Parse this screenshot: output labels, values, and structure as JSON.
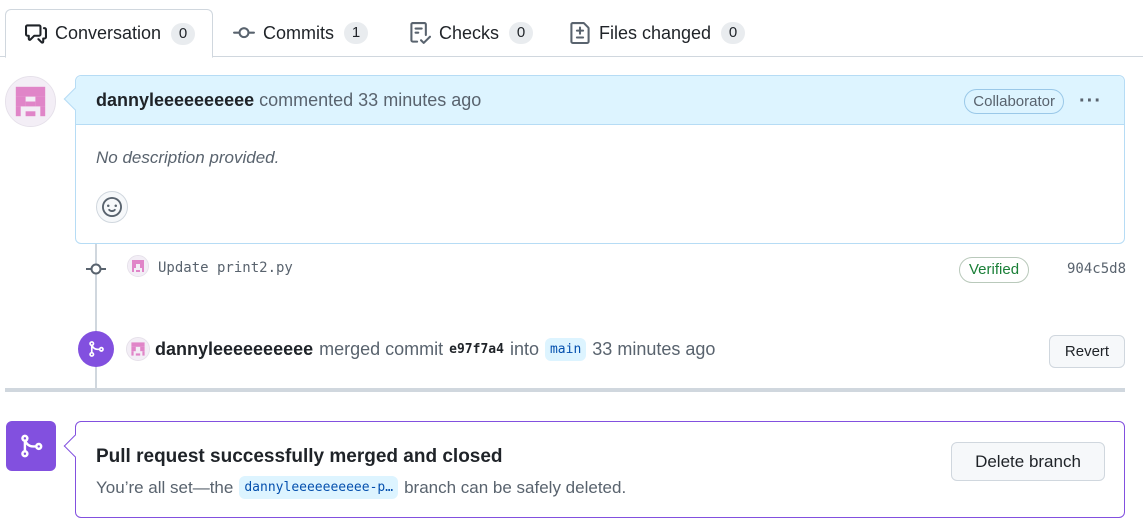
{
  "tabs": [
    {
      "label": "Conversation",
      "count": "0",
      "icon": "conversation-icon"
    },
    {
      "label": "Commits",
      "count": "1",
      "icon": "commit-icon"
    },
    {
      "label": "Checks",
      "count": "0",
      "icon": "checklist-icon"
    },
    {
      "label": "Files changed",
      "count": "0",
      "icon": "file-diff-icon"
    }
  ],
  "comment": {
    "author": "dannyleeeeeeeeee",
    "action": "commented",
    "time": "33 minutes ago",
    "badge": "Collaborator",
    "menu": "···",
    "body": "No description provided."
  },
  "commit": {
    "message": "Update print2.py",
    "verified": "Verified",
    "sha": "904c5d8"
  },
  "merge_event": {
    "author": "dannyleeeeeeeeee",
    "action": "merged commit",
    "sha": "e97f7a4",
    "into": "into",
    "branch": "main",
    "time": "33 minutes ago",
    "revert_label": "Revert"
  },
  "merged_status": {
    "title": "Pull request successfully merged and closed",
    "prefix": "You’re all set—the",
    "branch": "dannyleeeeeeeeee-p…",
    "suffix": "branch can be safely deleted.",
    "delete_label": "Delete branch"
  },
  "colors": {
    "accent_merged": "#8250df",
    "header_blue": "#ddf4ff",
    "verified_green": "#1a7f37"
  }
}
